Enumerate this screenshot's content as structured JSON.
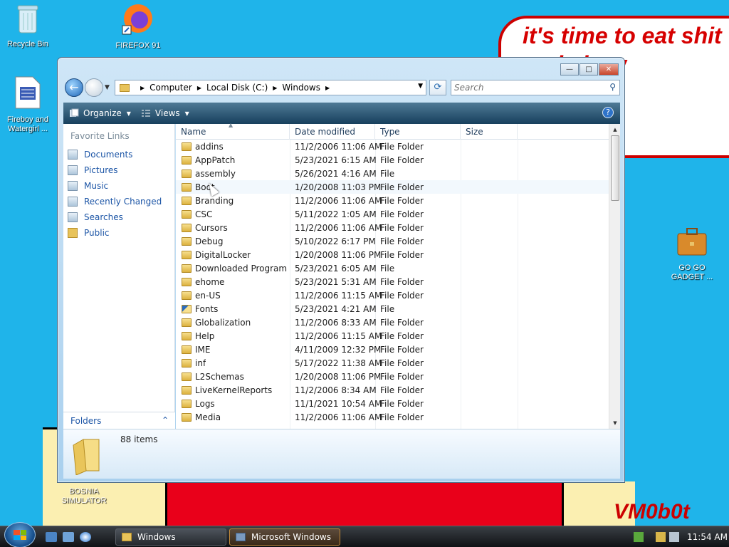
{
  "desktop": {
    "bubble_text": "it's time to eat shit\nand chew\num",
    "signature": "VM0b0t",
    "icons": [
      {
        "label": "Recycle Bin"
      },
      {
        "label": "FIREFOX 91"
      },
      {
        "label": "Fireboy and Watergirl ..."
      },
      {
        "label": "GO GO GADGET ..."
      },
      {
        "label": "BOSNIA SIMULATOR"
      }
    ]
  },
  "window": {
    "title_buttons": {
      "minimize": "—",
      "maximize": "□",
      "close": "✕"
    },
    "breadcrumb": [
      "Computer",
      "Local Disk (C:)",
      "Windows"
    ],
    "search_placeholder": "Search",
    "toolbar": {
      "organize": "Organize",
      "views": "Views",
      "help": "?"
    },
    "favorites": {
      "header": "Favorite Links",
      "items": [
        "Documents",
        "Pictures",
        "Music",
        "Recently Changed",
        "Searches",
        "Public"
      ]
    },
    "folders_label": "Folders",
    "columns": [
      "Name",
      "Date modified",
      "Type",
      "Size"
    ],
    "files": [
      {
        "name": "addins",
        "date": "11/2/2006 11:06 AM",
        "type": "File Folder"
      },
      {
        "name": "AppPatch",
        "date": "5/23/2021 6:15 AM",
        "type": "File Folder"
      },
      {
        "name": "assembly",
        "date": "5/26/2021 4:16 AM",
        "type": "File"
      },
      {
        "name": "Boot",
        "date": "1/20/2008 11:03 PM",
        "type": "File Folder"
      },
      {
        "name": "Branding",
        "date": "11/2/2006 11:06 AM",
        "type": "File Folder"
      },
      {
        "name": "CSC",
        "date": "5/11/2022 1:05 AM",
        "type": "File Folder"
      },
      {
        "name": "Cursors",
        "date": "11/2/2006 11:06 AM",
        "type": "File Folder"
      },
      {
        "name": "Debug",
        "date": "5/10/2022 6:17 PM",
        "type": "File Folder"
      },
      {
        "name": "DigitalLocker",
        "date": "1/20/2008 11:06 PM",
        "type": "File Folder"
      },
      {
        "name": "Downloaded Program ...",
        "date": "5/23/2021 6:05 AM",
        "type": "File"
      },
      {
        "name": "ehome",
        "date": "5/23/2021 5:31 AM",
        "type": "File Folder"
      },
      {
        "name": "en-US",
        "date": "11/2/2006 11:15 AM",
        "type": "File Folder"
      },
      {
        "name": "Fonts",
        "date": "5/23/2021 4:21 AM",
        "type": "File"
      },
      {
        "name": "Globalization",
        "date": "11/2/2006 8:33 AM",
        "type": "File Folder"
      },
      {
        "name": "Help",
        "date": "11/2/2006 11:15 AM",
        "type": "File Folder"
      },
      {
        "name": "IME",
        "date": "4/11/2009 12:32 PM",
        "type": "File Folder"
      },
      {
        "name": "inf",
        "date": "5/17/2022 11:38 AM",
        "type": "File Folder"
      },
      {
        "name": "L2Schemas",
        "date": "1/20/2008 11:06 PM",
        "type": "File Folder"
      },
      {
        "name": "LiveKernelReports",
        "date": "11/2/2006 8:34 AM",
        "type": "File Folder"
      },
      {
        "name": "Logs",
        "date": "11/1/2021 10:54 AM",
        "type": "File Folder"
      },
      {
        "name": "Media",
        "date": "11/2/2006 11:06 AM",
        "type": "File Folder"
      }
    ],
    "item_count": "88 items"
  },
  "taskbar": {
    "tasks": [
      "Windows",
      "Microsoft Windows"
    ],
    "clock": "11:54 AM"
  }
}
